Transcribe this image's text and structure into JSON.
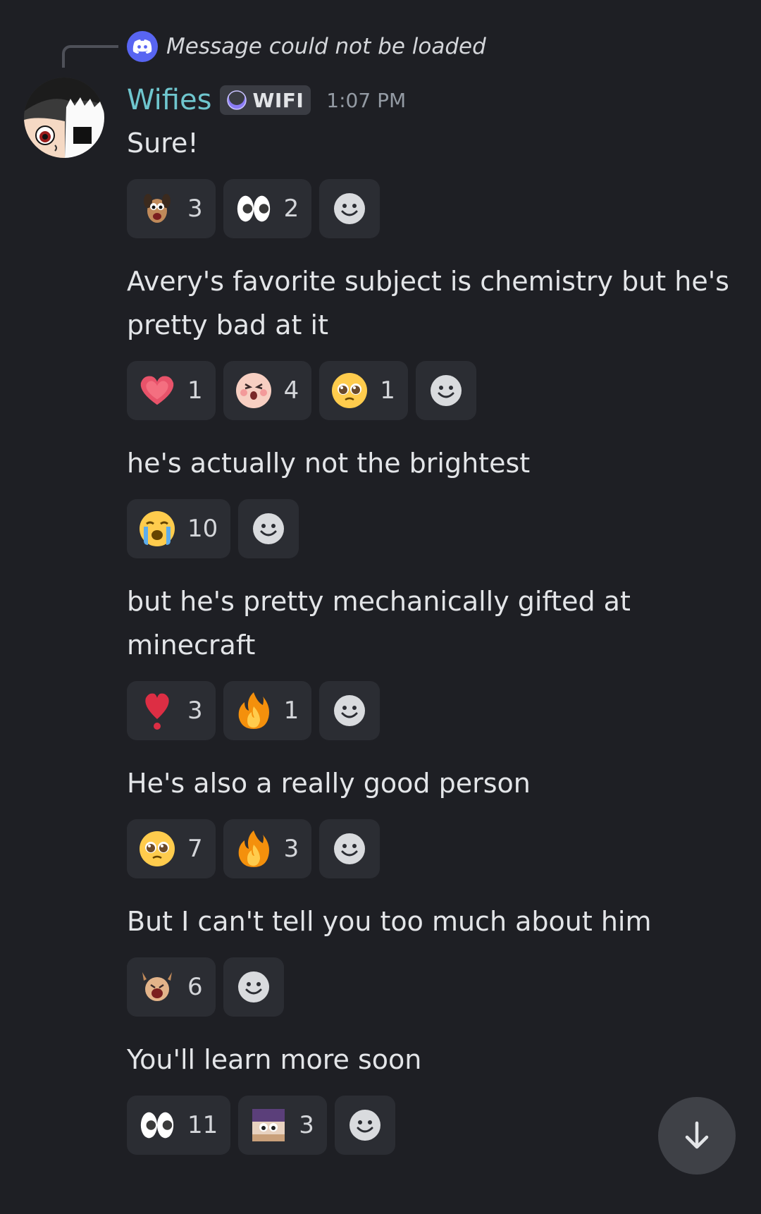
{
  "reply": {
    "text": "Message could not be loaded"
  },
  "author": {
    "name": "Wifies",
    "tag": "WIFI",
    "time": "1:07 PM"
  },
  "messages": [
    {
      "text": "Sure!",
      "reactions": [
        {
          "emoji": "cartoon-dog-emoji",
          "count": "3"
        },
        {
          "emoji": "eyes-emoji",
          "count": "2"
        }
      ]
    },
    {
      "text": "Avery's favorite subject is chemistry but he's pretty bad at it",
      "reactions": [
        {
          "emoji": "heart-emoji",
          "count": "1"
        },
        {
          "emoji": "surprised-face-emoji",
          "count": "4"
        },
        {
          "emoji": "pleading-face-emoji",
          "count": "1"
        }
      ]
    },
    {
      "text": "he's actually not the brightest",
      "reactions": [
        {
          "emoji": "crying-face-emoji",
          "count": "10"
        }
      ]
    },
    {
      "text": "but he's pretty mechanically gifted at minecraft",
      "reactions": [
        {
          "emoji": "heart-exclamation-emoji",
          "count": "3"
        },
        {
          "emoji": "fire-emoji",
          "count": "1"
        }
      ]
    },
    {
      "text": "He's also a really good person",
      "reactions": [
        {
          "emoji": "pleading-face-emoji",
          "count": "7"
        },
        {
          "emoji": "fire-emoji",
          "count": "3"
        }
      ]
    },
    {
      "text": "But I can't tell you too much about him",
      "reactions": [
        {
          "emoji": "shocked-creature-emoji",
          "count": "6"
        }
      ]
    },
    {
      "text": "You'll learn more soon",
      "reactions": [
        {
          "emoji": "eyes-emoji",
          "count": "11"
        },
        {
          "emoji": "peeking-face-emoji",
          "count": "3"
        }
      ]
    }
  ],
  "colors": {
    "background": "#1e1f24",
    "username": "#6fc6ce",
    "reaction_bg": "#2b2d33",
    "blurple": "#5865f2"
  }
}
